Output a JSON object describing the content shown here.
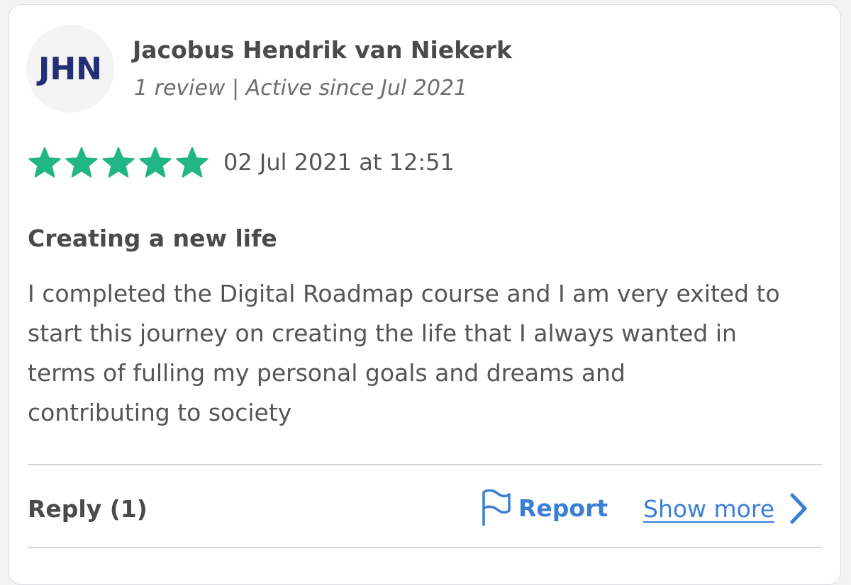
{
  "reviewer": {
    "initials": "JHN",
    "name": "Jacobus Hendrik van Niekerk",
    "meta": "1 review | Active since Jul 2021"
  },
  "review": {
    "rating": 5,
    "rating_max": 5,
    "star_icon": "star-icon",
    "date": "02 Jul 2021 at 12:51",
    "title": "Creating a new life",
    "body_lines": [
      "I completed the Digital Roadmap course and I am very exited to",
      "start this journey on creating the life that I always wanted in",
      "terms of fulling my personal goals and dreams and",
      "contributing to society"
    ]
  },
  "actions": {
    "reply_label": "Reply (1)",
    "report_label": "Report",
    "report_icon": "flag-icon",
    "show_more_label": "Show more",
    "show_more_icon": "chevron-right-icon"
  },
  "colors": {
    "star": "#22b585",
    "initials": "#232e74",
    "link": "#3a7fd5",
    "text_dark": "#4a4a4c",
    "text_body": "#555558"
  }
}
